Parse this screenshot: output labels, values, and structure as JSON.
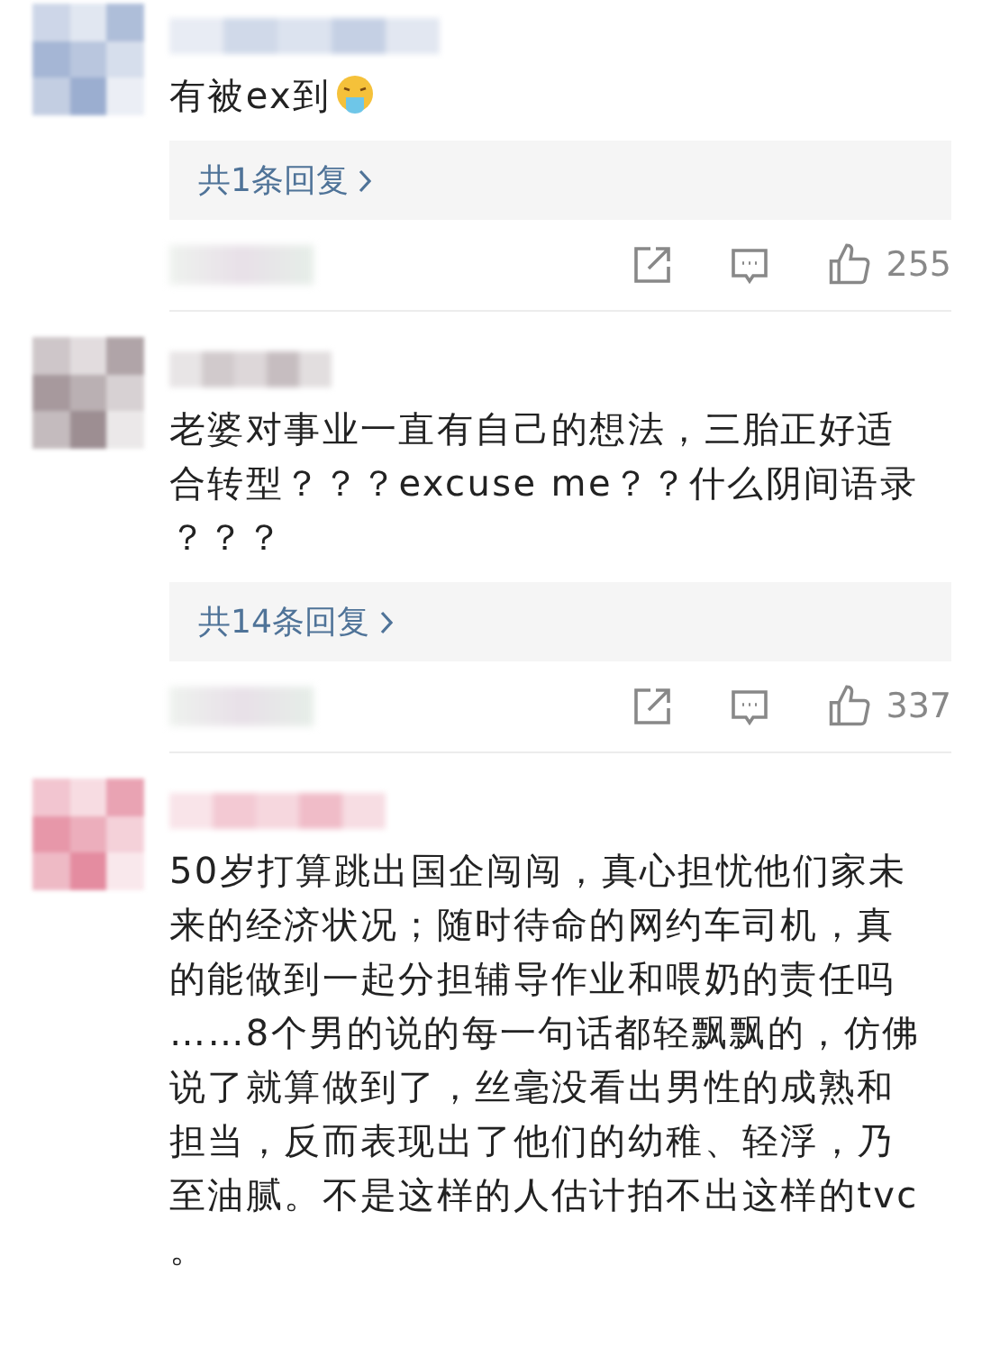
{
  "comments": [
    {
      "text": "有被ex到",
      "emoji": true,
      "reply_link": "共1条回复",
      "likes": "255"
    },
    {
      "text": "老婆对事业一直有自己的想法，三胎正好适合转型？？？excuse me？？什么阴间语录？？？",
      "reply_link": "共14条回复",
      "likes": "337"
    },
    {
      "text": "50岁打算跳出国企闯闯，真心担忧他们家未来的经济状况；随时待命的网约车司机，真的能做到一起分担辅导作业和喂奶的责任吗……8个男的说的每一句话都轻飘飘的，仿佛说了就算做到了，丝毫没看出男性的成熟和担当，反而表现出了他们的幼稚、轻浮，乃至油腻。不是这样的人估计拍不出这样的tvc。"
    }
  ]
}
